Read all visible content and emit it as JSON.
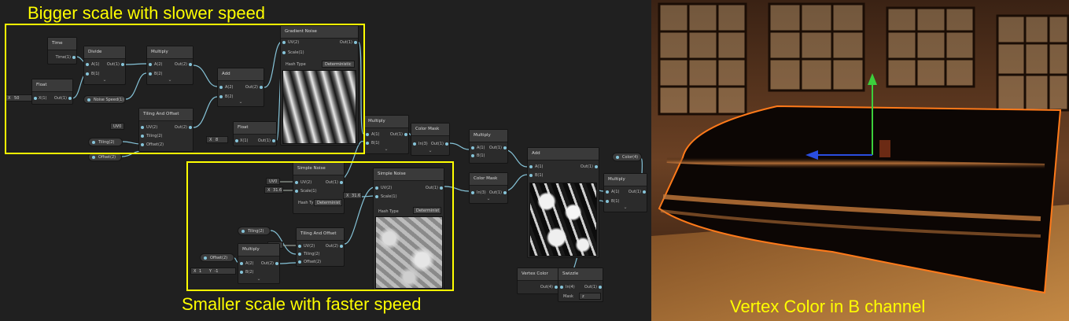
{
  "captions": {
    "top": "Bigger scale with slower speed",
    "bottom": "Smaller scale with faster speed",
    "viewport": "Vertex Color in B channel"
  },
  "colors": {
    "highlight": "#ffff00",
    "wire": "#86c4d9",
    "wire_gray": "#9aa39a",
    "node_bg": "#2b2b2b",
    "rim": "#ff7a1a"
  },
  "nodes": {
    "time": {
      "title": "Time",
      "out": "Time(1)"
    },
    "float": {
      "title": "Float",
      "field_label": "X",
      "field_value": "50",
      "in": "X(1)",
      "out": "Out(1)"
    },
    "divide": {
      "title": "Divide",
      "in_a": "A(1)",
      "in_b": "B(1)",
      "out": "Out(1)"
    },
    "noise_speed": {
      "label": "Noise Speed(1)"
    },
    "multiply1": {
      "title": "Multiply",
      "in_a": "A(2)",
      "in_b": "B(2)",
      "out": "Out(2)"
    },
    "gradient_noise": {
      "title": "Gradient Noise",
      "in_uv": "UV(2)",
      "in_scale": "Scale(1)",
      "out": "Out(1)",
      "hash_label": "Hash Type",
      "hash_value": "Deterministic"
    },
    "add1": {
      "title": "Add",
      "in_a": "A(2)",
      "in_b": "B(2)",
      "out": "Out(2)"
    },
    "tiling_offset1": {
      "title": "Tiling And Offset",
      "uv_value": "UV0",
      "in_uv": "UV(2)",
      "in_tiling": "Tiling(2)",
      "in_offset": "Offset(2)",
      "out": "Out(2)"
    },
    "tiling_pill1": {
      "label": "Tiling(2)"
    },
    "offset_pill1": {
      "label": "Offset(2)"
    },
    "float2": {
      "title": "Float",
      "field_label": "X",
      "field_value": "8",
      "in": "X(1)",
      "out": "Out(1)"
    },
    "multiply2": {
      "title": "Multiply",
      "in_a": "A(1)",
      "in_b": "B(1)",
      "out": "Out(1)"
    },
    "color_mask1": {
      "title": "Color Mask",
      "in": "In(3)",
      "out": "Out(1)"
    },
    "multiply3": {
      "title": "Multiply",
      "in_a": "A(1)",
      "in_b": "B(1)",
      "out": "Out(1)"
    },
    "simple_noise1": {
      "title": "Simple Noise",
      "uv_value": "UV0",
      "scale_label": "X",
      "scale_value": "31.6",
      "in_uv": "UV(2)",
      "in_scale": "Scale(1)",
      "out": "Out(1)",
      "hash_label": "Hash Ty",
      "hash_value": "Determinist"
    },
    "simple_noise2": {
      "title": "Simple Noise",
      "scale_label": "X",
      "scale_value": "31.6",
      "in_uv": "UV(2)",
      "in_scale": "Scale(1)",
      "out": "Out(1)",
      "hash_label": "Hash Type",
      "hash_value": "Determinist"
    },
    "color_mask2": {
      "title": "Color Mask",
      "in": "In(3)",
      "out": "Out(1)"
    },
    "add2": {
      "title": "Add",
      "in_a": "A(1)",
      "in_b": "B(1)",
      "out": "Out(1)"
    },
    "tiling_pill2": {
      "label": "Tiling(2)"
    },
    "tiling_offset2": {
      "title": "Tiling And Offset",
      "uv_value": "UV0",
      "in_uv": "UV(2)",
      "in_tiling": "Tiling(2)",
      "in_offset": "Offset(2)",
      "out": "Out(2)"
    },
    "offset_pill2": {
      "label": "Offset(2)"
    },
    "multiply4": {
      "title": "Multiply",
      "in_a": "A(2)",
      "in_b": "B(2)",
      "out": "Out(2)",
      "vx_label": "X",
      "vx_value": "1",
      "vy_label": "Y",
      "vy_value": "-1"
    },
    "color_pill": {
      "label": "Color(4)"
    },
    "multiply5": {
      "title": "Multiply",
      "in_a": "A(1)",
      "in_b": "B(1)",
      "out": "Out(1)"
    },
    "vertex_color": {
      "title": "Vertex Color",
      "out": "Out(4)"
    },
    "swizzle": {
      "title": "Swizzle",
      "in": "In(4)",
      "out": "Out(1)",
      "mask_label": "Mask",
      "mask_value": "z"
    }
  }
}
